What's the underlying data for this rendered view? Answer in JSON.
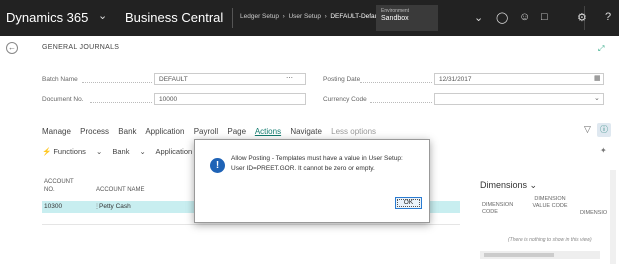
{
  "topbar": {
    "brand": "Dynamics 365",
    "app": "Business Central",
    "breadcrumb": [
      "Ledger Setup",
      "User Setup"
    ],
    "breadcrumb_current": "DEFAULT-Default Journal Batch",
    "environment_label": "Environment",
    "environment_value": "Sandbox",
    "icons": [
      "chevron-down-icon",
      "lightbulb-icon",
      "smiley-icon",
      "chat-icon",
      "gear-icon",
      "help-icon"
    ]
  },
  "page": {
    "title": "GENERAL JOURNALS"
  },
  "fields": {
    "batch_name": {
      "label": "Batch Name",
      "value": "DEFAULT"
    },
    "document_no": {
      "label": "Document No.",
      "value": "10000"
    },
    "posting_date": {
      "label": "Posting Date",
      "value": "12/31/2017"
    },
    "currency_code": {
      "label": "Currency Code",
      "value": ""
    }
  },
  "actionbar": {
    "items": [
      "Manage",
      "Process",
      "Bank",
      "Application",
      "Payroll",
      "Page",
      "Actions",
      "Navigate",
      "Less options"
    ],
    "active": "Actions"
  },
  "subbar": {
    "functions": "Functions",
    "bank": "Bank",
    "application": "Application"
  },
  "table": {
    "col1_line1": "ACCOUNT",
    "col1_line2": "NO.",
    "col2": "ACCOUNT NAME",
    "rows": [
      {
        "account_no": "10300",
        "account_name": "Petty Cash"
      }
    ]
  },
  "dimensions": {
    "title": "Dimensions",
    "col1": "DIMENSION CODE",
    "col2": "DIMENSION VALUE CODE",
    "col3": "DIMENSIO",
    "empty_text": "(There is nothing to show in this view)"
  },
  "dialog": {
    "message": "Allow Posting - Templates must have a value in User Setup: User ID=PREET.GOR. It cannot be zero or empty.",
    "ok_label": "OK"
  },
  "colors": {
    "topbar": "#222222",
    "accent": "#117a6e",
    "row_selected": "#c8eef0",
    "dialog_icon": "#1f63b6"
  }
}
